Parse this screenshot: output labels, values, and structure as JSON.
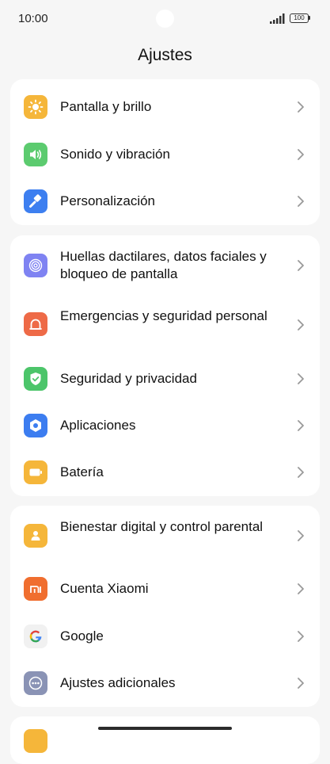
{
  "status_bar": {
    "time": "10:00",
    "battery": "100"
  },
  "header": {
    "title": "Ajustes"
  },
  "groups": [
    {
      "items": [
        {
          "label": "Pantalla y brillo",
          "icon": "brightness-icon",
          "color": "#f5b63a"
        },
        {
          "label": "Sonido y vibración",
          "icon": "speaker-icon",
          "color": "#5ccb6f"
        },
        {
          "label": "Personalización",
          "icon": "paintbrush-icon",
          "color": "#3d7ff0"
        }
      ]
    },
    {
      "items": [
        {
          "label": "Huellas dactilares, datos faciales y bloqueo de pantalla",
          "icon": "fingerprint-icon",
          "color": "#7f83f2"
        },
        {
          "label": "Emergencias y seguridad personal",
          "icon": "emergency-alarm-icon",
          "color": "#ee6a47"
        },
        {
          "label": "Seguridad y privacidad",
          "icon": "shield-check-icon",
          "color": "#4cc56a"
        },
        {
          "label": "Aplicaciones",
          "icon": "apps-hexagon-icon",
          "color": "#3c7df0"
        },
        {
          "label": "Batería",
          "icon": "battery-icon",
          "color": "#f5b63a"
        }
      ]
    },
    {
      "items": [
        {
          "label": "Bienestar digital y control parental",
          "icon": "wellbeing-icon",
          "color": "#f5b63a"
        },
        {
          "label": "Cuenta Xiaomi",
          "icon": "xiaomi-logo-icon",
          "color": "#f06e2f"
        },
        {
          "label": "Google",
          "icon": "google-g-icon",
          "color": "#f1f1f1"
        },
        {
          "label": "Ajustes adicionales",
          "icon": "more-dots-icon",
          "color": "#8a93b5"
        }
      ]
    }
  ]
}
